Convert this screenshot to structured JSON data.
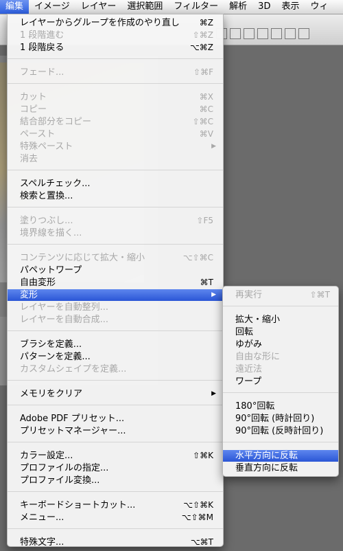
{
  "menubar": {
    "items": [
      "編集",
      "イメージ",
      "レイヤー",
      "選択範囲",
      "フィルター",
      "解析",
      "3D",
      "表示",
      "ウィ"
    ]
  },
  "edit_menu": {
    "items": [
      {
        "label": "レイヤーからグループを作成のやり直し",
        "shortcut": "⌘Z",
        "enabled": true
      },
      {
        "label": "1 段階進む",
        "shortcut": "⇧⌘Z",
        "enabled": false
      },
      {
        "label": "1 段階戻る",
        "shortcut": "⌥⌘Z",
        "enabled": true
      },
      {
        "label": "フェード...",
        "shortcut": "⇧⌘F",
        "enabled": false
      },
      {
        "label": "カット",
        "shortcut": "⌘X",
        "enabled": false
      },
      {
        "label": "コピー",
        "shortcut": "⌘C",
        "enabled": false
      },
      {
        "label": "結合部分をコピー",
        "shortcut": "⇧⌘C",
        "enabled": false
      },
      {
        "label": "ペースト",
        "shortcut": "⌘V",
        "enabled": false
      },
      {
        "label": "特殊ペースト",
        "shortcut": "",
        "enabled": false
      },
      {
        "label": "消去",
        "shortcut": "",
        "enabled": false
      },
      {
        "label": "スペルチェック...",
        "shortcut": "",
        "enabled": true
      },
      {
        "label": "検索と置換...",
        "shortcut": "",
        "enabled": true
      },
      {
        "label": "塗りつぶし...",
        "shortcut": "⇧F5",
        "enabled": false
      },
      {
        "label": "境界線を描く...",
        "shortcut": "",
        "enabled": false
      },
      {
        "label": "コンテンツに応じて拡大・縮小",
        "shortcut": "⌥⇧⌘C",
        "enabled": false
      },
      {
        "label": "パペットワープ",
        "shortcut": "",
        "enabled": true
      },
      {
        "label": "自由変形",
        "shortcut": "⌘T",
        "enabled": true
      },
      {
        "label": "変形",
        "shortcut": "",
        "enabled": true
      },
      {
        "label": "レイヤーを自動整列...",
        "shortcut": "",
        "enabled": false
      },
      {
        "label": "レイヤーを自動合成...",
        "shortcut": "",
        "enabled": false
      },
      {
        "label": "ブラシを定義...",
        "shortcut": "",
        "enabled": true
      },
      {
        "label": "パターンを定義...",
        "shortcut": "",
        "enabled": true
      },
      {
        "label": "カスタムシェイプを定義...",
        "shortcut": "",
        "enabled": false
      },
      {
        "label": "メモリをクリア",
        "shortcut": "",
        "enabled": true
      },
      {
        "label": "Adobe PDF プリセット...",
        "shortcut": "",
        "enabled": true
      },
      {
        "label": "プリセットマネージャー...",
        "shortcut": "",
        "enabled": true
      },
      {
        "label": "カラー設定...",
        "shortcut": "⇧⌘K",
        "enabled": true
      },
      {
        "label": "プロファイルの指定...",
        "shortcut": "",
        "enabled": true
      },
      {
        "label": "プロファイル変換...",
        "shortcut": "",
        "enabled": true
      },
      {
        "label": "キーボードショートカット...",
        "shortcut": "⌥⇧⌘K",
        "enabled": true
      },
      {
        "label": "メニュー...",
        "shortcut": "⌥⇧⌘M",
        "enabled": true
      },
      {
        "label": "特殊文字...",
        "shortcut": "⌥⌘T",
        "enabled": true
      }
    ]
  },
  "transform_submenu": {
    "items": [
      {
        "label": "再実行",
        "shortcut": "⇧⌘T",
        "enabled": false
      },
      {
        "label": "拡大・縮小",
        "shortcut": "",
        "enabled": true
      },
      {
        "label": "回転",
        "shortcut": "",
        "enabled": true
      },
      {
        "label": "ゆがみ",
        "shortcut": "",
        "enabled": true
      },
      {
        "label": "自由な形に",
        "shortcut": "",
        "enabled": false
      },
      {
        "label": "遠近法",
        "shortcut": "",
        "enabled": false
      },
      {
        "label": "ワープ",
        "shortcut": "",
        "enabled": true
      },
      {
        "label": "180°回転",
        "shortcut": "",
        "enabled": true
      },
      {
        "label": "90°回転 (時計回り)",
        "shortcut": "",
        "enabled": true
      },
      {
        "label": "90°回転 (反時計回り)",
        "shortcut": "",
        "enabled": true
      },
      {
        "label": "水平方向に反転",
        "shortcut": "",
        "enabled": true
      },
      {
        "label": "垂直方向に反転",
        "shortcut": "",
        "enabled": true
      }
    ]
  },
  "colors": {
    "highlight": "#2a56d6",
    "disabled": "#a8a8a8"
  }
}
